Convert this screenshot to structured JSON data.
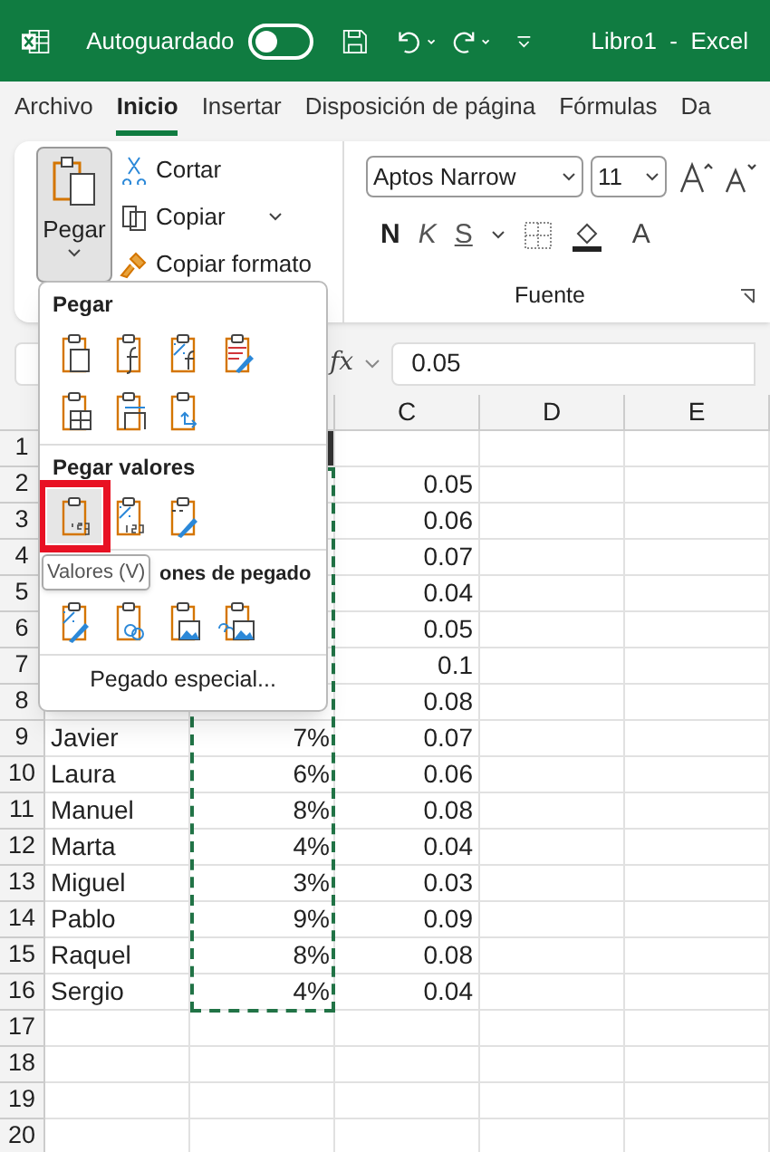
{
  "title_bar": {
    "autosave_label": "Autoguardado",
    "autosave_on": false,
    "title": "Libro1  -  Excel"
  },
  "menu_tabs": [
    {
      "label": "Archivo",
      "selected": false
    },
    {
      "label": "Inicio",
      "selected": true
    },
    {
      "label": "Insertar",
      "selected": false
    },
    {
      "label": "Disposición de página",
      "selected": false
    },
    {
      "label": "Fórmulas",
      "selected": false
    },
    {
      "label": "Da",
      "selected": false
    }
  ],
  "ribbon": {
    "paste_button": "Pegar",
    "clipboard": [
      "Cortar",
      "Copiar",
      "Copiar formato"
    ],
    "font_name": "Aptos Narrow",
    "font_size": "11",
    "bold": "N",
    "italic": "K",
    "underline": "S",
    "font_color": "A",
    "group_label": "Fuente"
  },
  "formula_bar": {
    "fx": "fx",
    "value": "0.05"
  },
  "columns": [
    "C",
    "D",
    "E"
  ],
  "rows": [
    {
      "num": "1",
      "a": "",
      "b": "",
      "b_filled": true,
      "c": ""
    },
    {
      "num": "2",
      "a": "",
      "b": "",
      "b_filled": false,
      "c": "0.05"
    },
    {
      "num": "3",
      "a": "",
      "b": "",
      "b_filled": false,
      "c": "0.06"
    },
    {
      "num": "4",
      "a": "",
      "b": "",
      "b_filled": false,
      "c": "0.07"
    },
    {
      "num": "5",
      "a": "",
      "b": "",
      "b_filled": false,
      "c": "0.04"
    },
    {
      "num": "6",
      "a": "",
      "b": "",
      "b_filled": false,
      "c": "0.05"
    },
    {
      "num": "7",
      "a": "",
      "b": "",
      "b_filled": false,
      "c": "0.1"
    },
    {
      "num": "8",
      "a": "",
      "b": "",
      "b_filled": false,
      "c": "0.08"
    },
    {
      "num": "9",
      "a": "Javier",
      "b": "7%",
      "b_filled": false,
      "c": "0.07"
    },
    {
      "num": "10",
      "a": "Laura",
      "b": "6%",
      "b_filled": false,
      "c": "0.06"
    },
    {
      "num": "11",
      "a": "Manuel",
      "b": "8%",
      "b_filled": false,
      "c": "0.08"
    },
    {
      "num": "12",
      "a": "Marta",
      "b": "4%",
      "b_filled": false,
      "c": "0.04"
    },
    {
      "num": "13",
      "a": "Miguel",
      "b": "3%",
      "b_filled": false,
      "c": "0.03"
    },
    {
      "num": "14",
      "a": "Pablo",
      "b": "9%",
      "b_filled": false,
      "c": "0.09"
    },
    {
      "num": "15",
      "a": "Raquel",
      "b": "8%",
      "b_filled": false,
      "c": "0.08"
    },
    {
      "num": "16",
      "a": "Sergio",
      "b": "4%",
      "b_filled": false,
      "c": "0.04"
    },
    {
      "num": "17",
      "a": "",
      "b": "",
      "b_filled": false,
      "c": ""
    },
    {
      "num": "18",
      "a": "",
      "b": "",
      "b_filled": false,
      "c": ""
    },
    {
      "num": "19",
      "a": "",
      "b": "",
      "b_filled": false,
      "c": ""
    },
    {
      "num": "20",
      "a": "",
      "b": "",
      "b_filled": false,
      "c": ""
    }
  ],
  "paste_menu": {
    "sections": [
      {
        "heading": "Pegar",
        "items": [
          {
            "kind": "paste",
            "selected": false
          },
          {
            "kind": "formulas",
            "selected": false
          },
          {
            "kind": "formulas-number",
            "selected": false
          },
          {
            "kind": "formatting",
            "selected": false
          },
          {
            "kind": "no-borders",
            "selected": false
          },
          {
            "kind": "column-widths",
            "selected": false
          },
          {
            "kind": "transpose",
            "selected": false
          }
        ]
      },
      {
        "heading": "Pegar valores",
        "items": [
          {
            "kind": "values",
            "selected": true
          },
          {
            "kind": "values-number",
            "selected": false
          },
          {
            "kind": "values-source",
            "selected": false
          }
        ]
      },
      {
        "heading": "ones de pegado",
        "items": [
          {
            "kind": "format",
            "selected": false
          },
          {
            "kind": "link",
            "selected": false
          },
          {
            "kind": "picture",
            "selected": false
          },
          {
            "kind": "linked-picture",
            "selected": false
          }
        ]
      }
    ],
    "special": "Pegado especial...",
    "tooltip": "Valores (V)"
  }
}
